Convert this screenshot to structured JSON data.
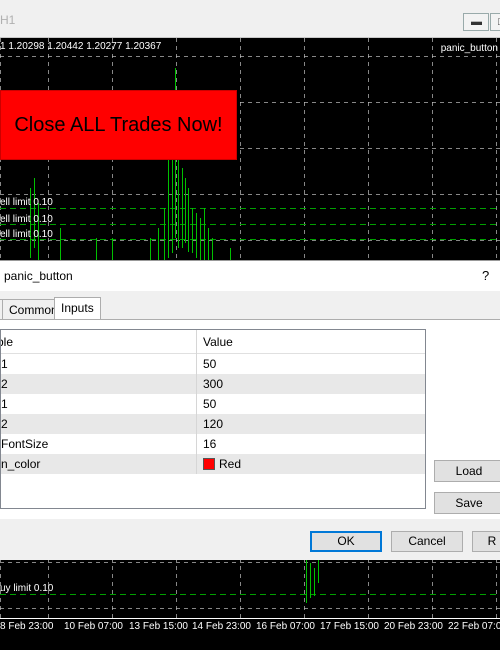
{
  "window": {
    "title": "H1"
  },
  "chart": {
    "ohlc": "1  1.20298  1.20442  1.20277  1.20367",
    "indicator_name": "panic_button",
    "panic_button_label": "Close ALL Trades Now!",
    "order_labels": [
      "ell limit 0.10",
      "ell limit 0.10",
      "ell limit 0.10"
    ],
    "bottom_order_label": "uy limit 0.10",
    "dates": [
      "8 Feb 23:00",
      "10 Feb 07:00",
      "13 Feb 15:00",
      "14 Feb 23:00",
      "16 Feb 07:00",
      "17 Feb 15:00",
      "20 Feb 23:00",
      "22 Feb 07:00"
    ],
    "colors": {
      "background": "#000000",
      "bars": "#00c000",
      "grid": "#c0c0c0",
      "button": "#ff0000"
    }
  },
  "dialog": {
    "title": "panic_button",
    "help": "?",
    "tabs": [
      "",
      "Common",
      "Inputs"
    ],
    "active_tab": "Inputs",
    "columns": [
      "ble",
      "Value"
    ],
    "rows": [
      {
        "name": "1",
        "value": "50"
      },
      {
        "name": "2",
        "value": "300"
      },
      {
        "name": "1",
        "value": "50"
      },
      {
        "name": "2",
        "value": "120"
      },
      {
        "name": "FontSize",
        "value": "16"
      },
      {
        "name": "n_color",
        "value": "Red",
        "color": "#ff0000"
      }
    ],
    "load_label": "Load",
    "save_label": "Save",
    "ok_label": "OK",
    "cancel_label": "Cancel",
    "reset_label": "R"
  }
}
